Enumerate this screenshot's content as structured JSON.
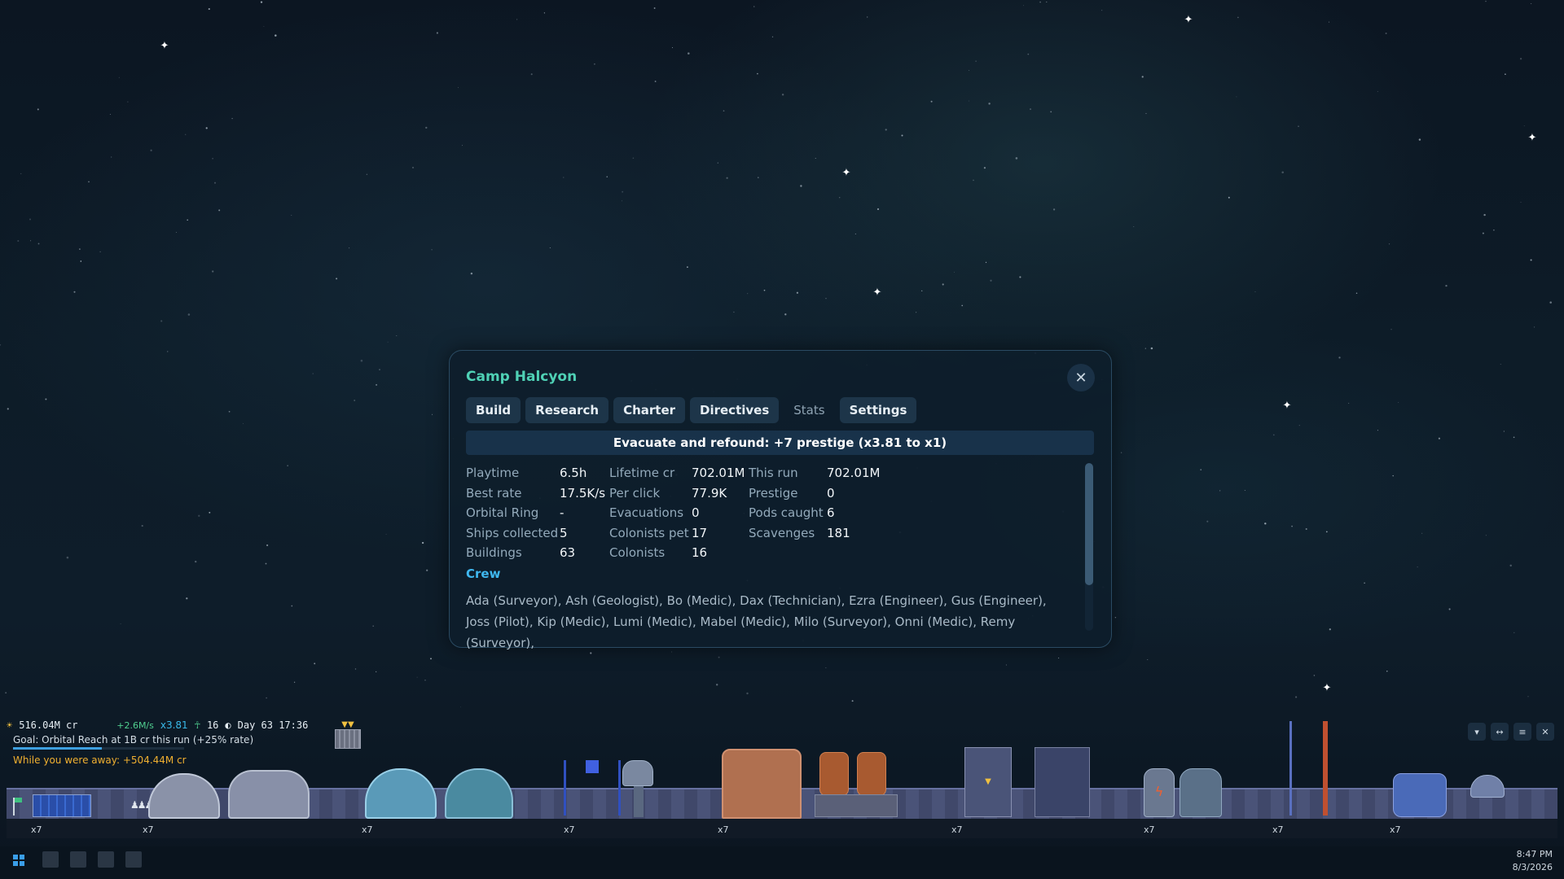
{
  "dialog": {
    "title": "Camp Halcyon",
    "tabs": [
      {
        "label": "Build"
      },
      {
        "label": "Research"
      },
      {
        "label": "Charter"
      },
      {
        "label": "Directives"
      },
      {
        "label": "Stats",
        "active": true
      },
      {
        "label": "Settings"
      }
    ],
    "banner": "Evacuate and refound: +7 prestige (x3.81 to x1)",
    "stats": [
      [
        "Playtime",
        "6.5h",
        "Lifetime cr",
        "702.01M",
        "This run",
        "702.01M"
      ],
      [
        "Best rate",
        "17.5K/s",
        "Per click",
        "77.9K",
        "Prestige",
        "0"
      ],
      [
        "Orbital Ring",
        "-",
        "Evacuations",
        "0",
        "Pods caught",
        "6"
      ],
      [
        "Ships collected",
        "5",
        "Colonists pet",
        "17",
        "Scavenges",
        "181"
      ],
      [
        "Buildings",
        "63",
        "Colonists",
        "16",
        "",
        ""
      ]
    ],
    "crew_heading": "Crew",
    "crew_text": "Ada (Surveyor),  Ash (Geologist),  Bo (Medic),  Dax (Technician),  Ezra (Engineer),  Gus (Engineer),  Joss (Pilot),  Kip (Medic),  Lumi (Medic),  Mabel (Medic),  Milo (Surveyor),  Onni (Medic),  Remy (Surveyor),"
  },
  "hud": {
    "credits": "516.04M cr",
    "rate": "+2.6M/s",
    "multiplier": "x3.81",
    "colonists": "16",
    "day": "Day 63 17:36",
    "goal": "Goal: Orbital Reach at 1B cr this run (+25% rate)",
    "goal_progress": 0.52,
    "away": "While you were away: +504.44M cr",
    "multipliers": [
      "x7",
      "x7",
      "x7",
      "x7",
      "x7",
      "x7",
      "x7",
      "x7",
      "x7"
    ]
  },
  "taskbar": {
    "time": "8:47 PM",
    "date": "8/3/2026"
  },
  "colors": {
    "accent_title": "#4fd1b5",
    "crew_heading": "#3fb8f0",
    "away_text": "#f0b030",
    "rate_text": "#50d090"
  }
}
